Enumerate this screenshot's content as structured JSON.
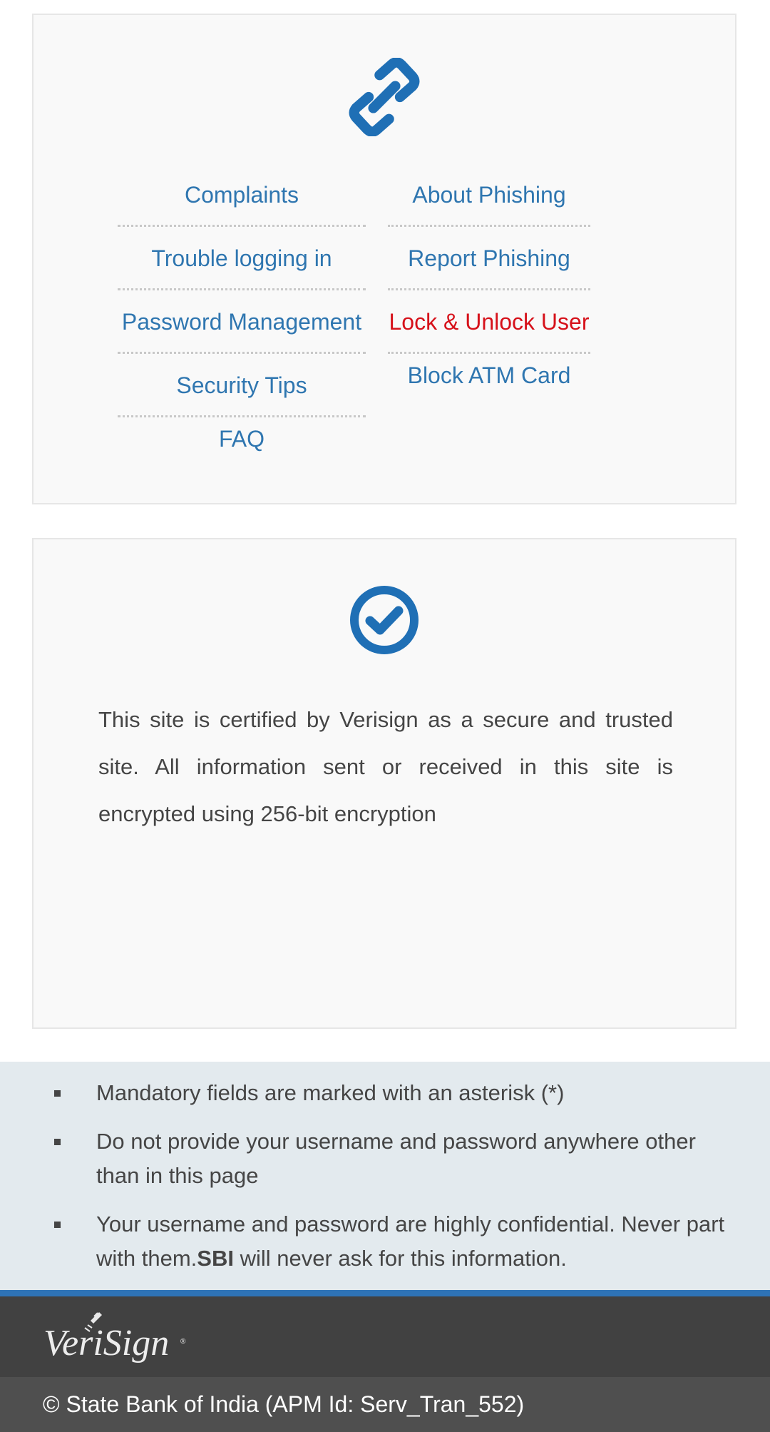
{
  "links": {
    "left": [
      {
        "label": "Complaints"
      },
      {
        "label": "Trouble logging in"
      },
      {
        "label": "Password Management"
      },
      {
        "label": "Security Tips"
      },
      {
        "label": "FAQ"
      }
    ],
    "right": [
      {
        "label": "About Phishing"
      },
      {
        "label": "Report Phishing"
      },
      {
        "label": "Lock & Unlock User"
      },
      {
        "label": "Block ATM Card"
      }
    ],
    "active_label": "Lock & Unlock User",
    "link_color": "#2f76b0",
    "active_color": "#d6111a",
    "icon": "link-icon"
  },
  "certification": {
    "icon": "check-circle-icon",
    "text": "This site is certified by Verisign as a secure and trusted site. All information sent or received in this site is encrypted using 256-bit encryption"
  },
  "notes": {
    "items": [
      {
        "text": "Mandatory fields are marked with an asterisk (*)"
      },
      {
        "text": "Do not provide your username and password anywhere other than in this page"
      },
      {
        "text_before": "Your username and password are highly confidential. Never part with them.",
        "bold": "SBI",
        "text_after": " will never ask for this information."
      }
    ]
  },
  "footer": {
    "logo_text": "VeriSign",
    "copyright": "© State Bank of India (APM Id: Serv_Tran_552)",
    "accent_color": "#2e73b6"
  }
}
